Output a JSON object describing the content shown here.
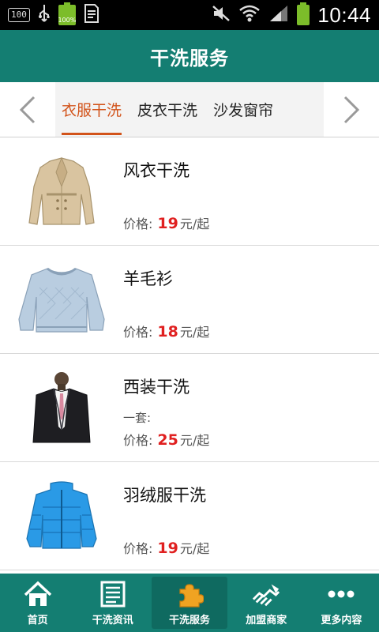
{
  "status_bar": {
    "left_box_text": "100",
    "battery_small_text": "100%",
    "time": "10:44"
  },
  "header": {
    "title": "干洗服务"
  },
  "tabs": {
    "items": [
      {
        "label": "衣服干洗",
        "active": true
      },
      {
        "label": "皮衣干洗",
        "active": false
      },
      {
        "label": "沙发窗帘",
        "active": false
      }
    ]
  },
  "products": [
    {
      "name": "风衣干洗",
      "subtitle": "",
      "price_label": "价格:",
      "price": "19",
      "unit": "元/起",
      "image": "trench-coat"
    },
    {
      "name": "羊毛衫",
      "subtitle": "",
      "price_label": "价格:",
      "price": "18",
      "unit": "元/起",
      "image": "sweater"
    },
    {
      "name": "西装干洗",
      "subtitle": "一套:",
      "price_label": "价格:",
      "price": "25",
      "unit": "元/起",
      "image": "suit"
    },
    {
      "name": "羽绒服干洗",
      "subtitle": "",
      "price_label": "价格:",
      "price": "19",
      "unit": "元/起",
      "image": "down-jacket"
    }
  ],
  "bottom_nav": {
    "items": [
      {
        "label": "首页",
        "icon": "home-icon",
        "active": false
      },
      {
        "label": "干洗资讯",
        "icon": "news-icon",
        "active": false
      },
      {
        "label": "干洗服务",
        "icon": "puzzle-icon",
        "active": true
      },
      {
        "label": "加盟商家",
        "icon": "handshake-icon",
        "active": false
      },
      {
        "label": "更多内容",
        "icon": "more-icon",
        "active": false
      }
    ]
  },
  "colors": {
    "primary": "#147e72",
    "tab_active": "#d2531a",
    "price": "#e02020"
  }
}
